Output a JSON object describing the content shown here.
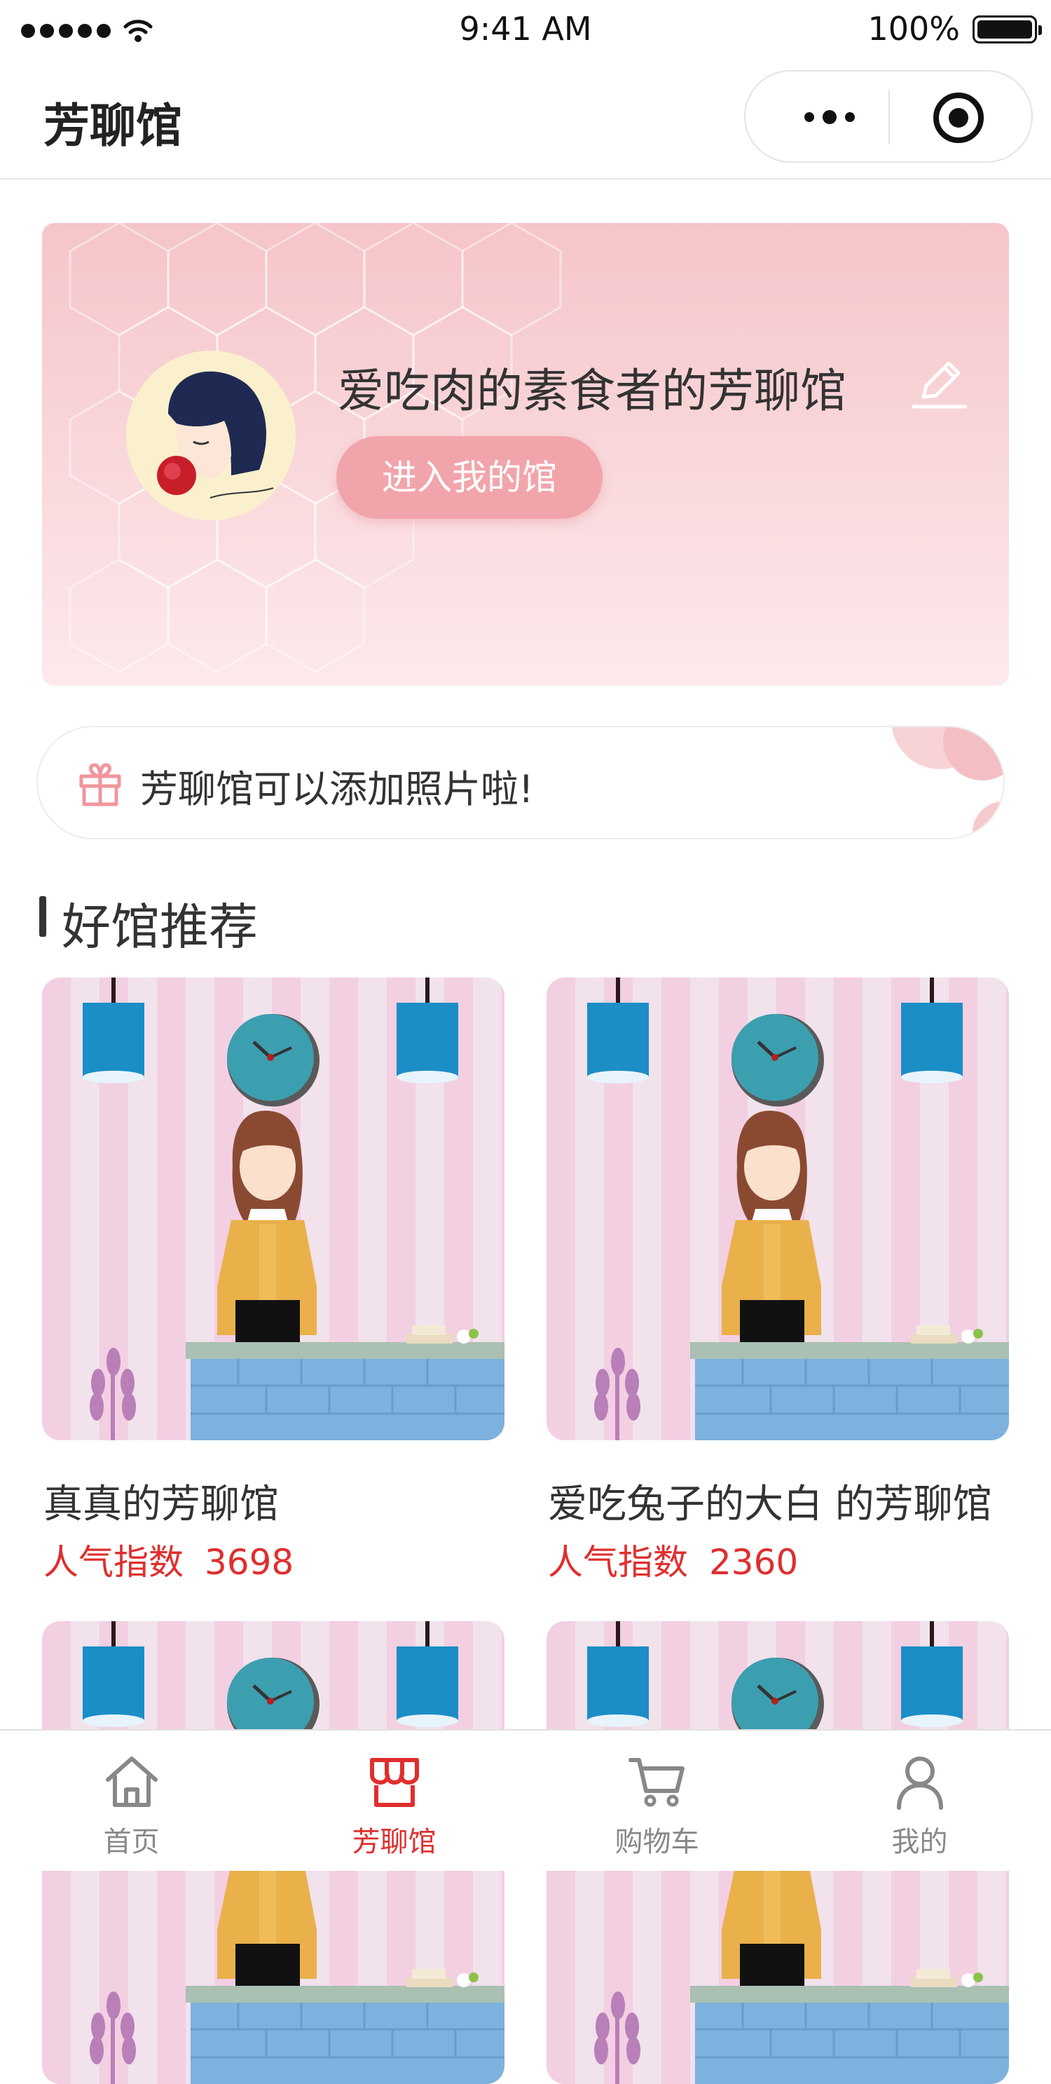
{
  "status_bar": {
    "time": "9:41 AM",
    "battery": "100%"
  },
  "nav": {
    "title": "芳聊馆"
  },
  "banner": {
    "name": "爱吃肉的素食者的芳聊馆",
    "enter_button": "进入我的馆"
  },
  "notice": {
    "text": "芳聊馆可以添加照片啦!"
  },
  "section": {
    "title": "好馆推荐"
  },
  "cards": [
    {
      "name": "真真的芳聊馆",
      "pop_label": "人气指数",
      "pop_value": "3698"
    },
    {
      "name": "爱吃兔子的大白 的芳聊馆",
      "pop_label": "人气指数",
      "pop_value": "2360"
    }
  ],
  "tabbar": [
    {
      "label": "首页",
      "icon": "home-icon"
    },
    {
      "label": "芳聊馆",
      "icon": "shop-icon",
      "active": true
    },
    {
      "label": "购物车",
      "icon": "cart-icon"
    },
    {
      "label": "我的",
      "icon": "user-icon"
    }
  ],
  "colors": {
    "accent": "#e02e2e",
    "banner_pink": "#f5c5c9",
    "button_pink": "#f1a5ab"
  }
}
